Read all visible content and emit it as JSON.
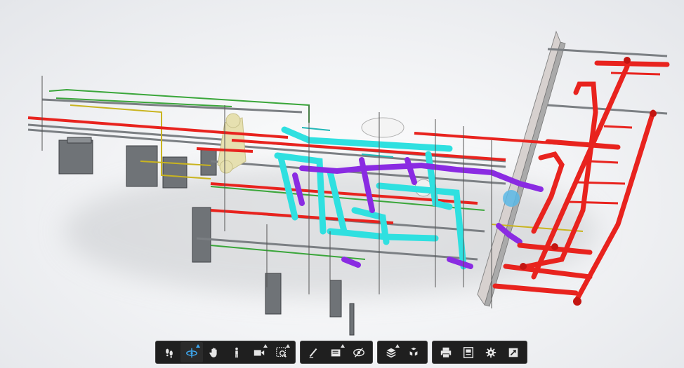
{
  "viewer": {
    "background_color": "#eef0f3",
    "selected_tool": "orbit-tool",
    "active_color": "#3ea8f0",
    "icon_color": "#e6e6e6",
    "model_colors": {
      "fire_protection": "#e8231e",
      "chilled_water": "#2fe0e0",
      "heating": "#8a2be2",
      "structure": "#9aa0a6",
      "green_pipe": "#3aa63a",
      "yellow_pipe": "#c9b41f",
      "beige_duct": "#e6e0b0"
    }
  },
  "toolbar": {
    "groups": [
      {
        "name": "navigation",
        "tools": [
          "walk-icon",
          "orbit-icon",
          "pan-icon",
          "person-icon",
          "camera-icon",
          "zoom-window-icon"
        ]
      },
      {
        "name": "markup",
        "tools": [
          "measure-icon",
          "section-icon",
          "hide-icon"
        ]
      },
      {
        "name": "model",
        "tools": [
          "model-browser-icon",
          "explode-icon"
        ]
      },
      {
        "name": "settings",
        "tools": [
          "print-icon",
          "properties-icon",
          "settings-icon",
          "fullscreen-icon"
        ]
      }
    ]
  }
}
